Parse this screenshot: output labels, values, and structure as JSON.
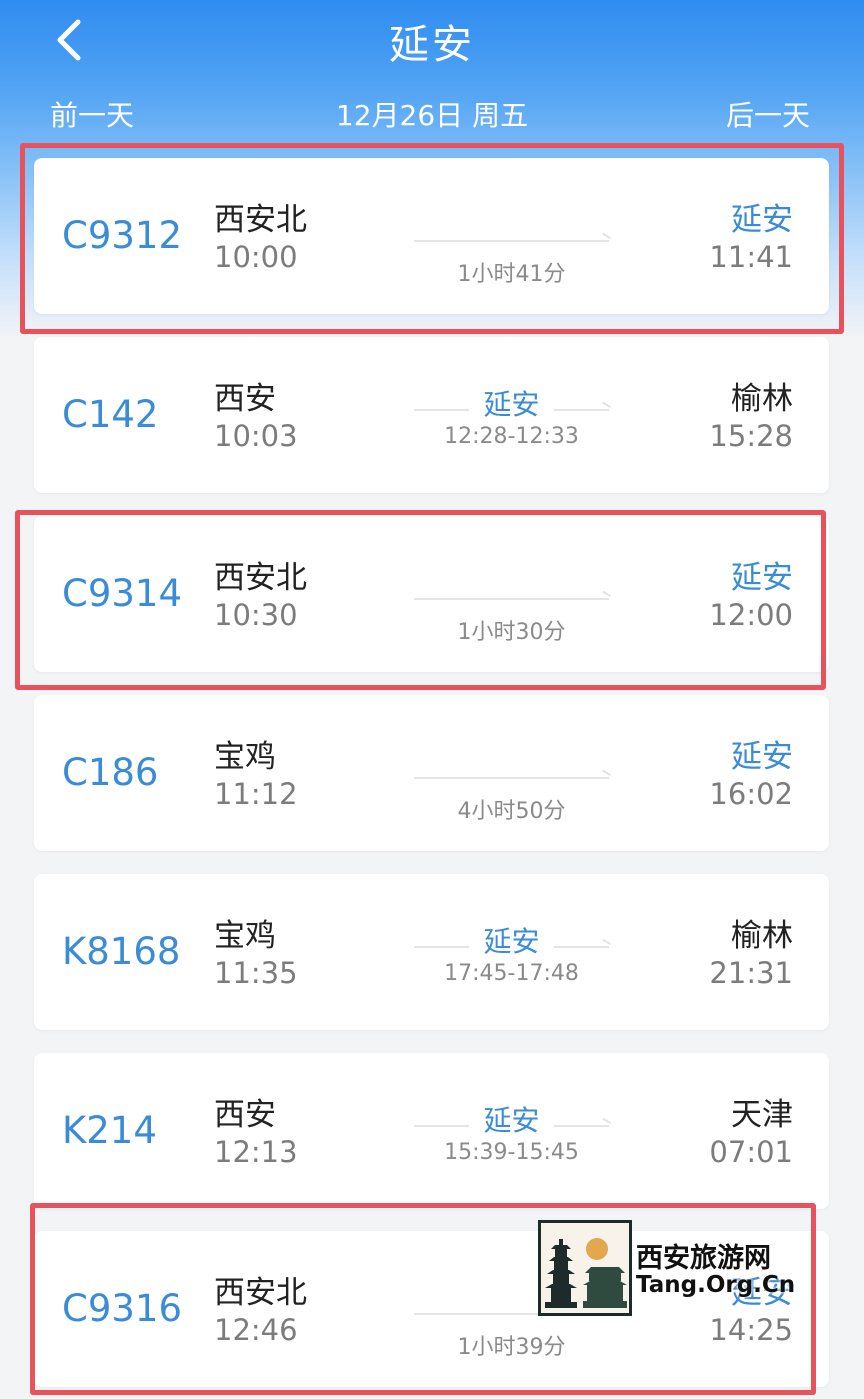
{
  "header": {
    "title": "延安",
    "back_icon": "chevron-left-icon",
    "prev_day": "前一天",
    "current_date": "12月26日 周五",
    "next_day": "后一天"
  },
  "colors": {
    "header_blue": "#2f8cf0",
    "train_code_blue": "#3a8bd8",
    "highlight_red": "#e8525d",
    "page_background": "#f3f4f6"
  },
  "trains": [
    {
      "code": "C9312",
      "from": "西安北",
      "dep": "10:00",
      "to": "延安",
      "to_highlighted": true,
      "arr": "11:41",
      "duration": "1小时41分"
    },
    {
      "code": "C142",
      "from": "西安",
      "dep": "10:03",
      "to": "榆林",
      "to_highlighted": false,
      "arr": "15:28",
      "via": "延安",
      "via_times": "12:28-12:33"
    },
    {
      "code": "C9314",
      "from": "西安北",
      "dep": "10:30",
      "to": "延安",
      "to_highlighted": true,
      "arr": "12:00",
      "duration": "1小时30分"
    },
    {
      "code": "C186",
      "from": "宝鸡",
      "dep": "11:12",
      "to": "延安",
      "to_highlighted": true,
      "arr": "16:02",
      "duration": "4小时50分"
    },
    {
      "code": "K8168",
      "from": "宝鸡",
      "dep": "11:35",
      "to": "榆林",
      "to_highlighted": false,
      "arr": "21:31",
      "via": "延安",
      "via_times": "17:45-17:48"
    },
    {
      "code": "K214",
      "from": "西安",
      "dep": "12:13",
      "to": "天津",
      "to_highlighted": false,
      "arr": "07:01",
      "via": "延安",
      "via_times": "15:39-15:45"
    },
    {
      "code": "C9316",
      "from": "西安北",
      "dep": "12:46",
      "to": "延安",
      "to_highlighted": true,
      "arr": "14:25",
      "duration": "1小时39分"
    }
  ],
  "watermark": {
    "title": "西安旅游网",
    "url": "Tang.Org.Cn",
    "logo_icon": "pagoda-logo-icon"
  }
}
